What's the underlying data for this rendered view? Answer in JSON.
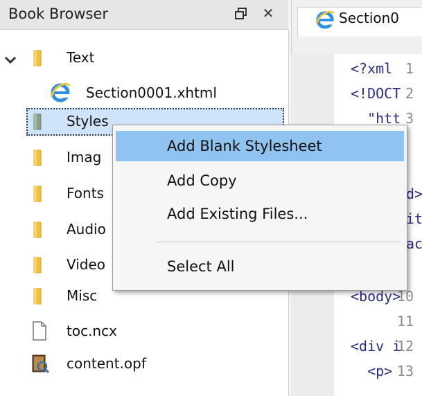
{
  "panel": {
    "title": "Book Browser"
  },
  "tree": {
    "items": [
      {
        "label": "Text",
        "icon": "folder-icon",
        "expanded": true
      },
      {
        "label": "Section0001.xhtml",
        "icon": "ie-icon"
      },
      {
        "label": "Styles",
        "icon": "folder-icon",
        "selected": true
      },
      {
        "label": "Imag",
        "icon": "folder-icon"
      },
      {
        "label": "Fonts",
        "icon": "folder-icon"
      },
      {
        "label": "Audio",
        "icon": "folder-icon"
      },
      {
        "label": "Video",
        "icon": "folder-icon"
      },
      {
        "label": "Misc",
        "icon": "folder-icon"
      },
      {
        "label": "toc.ncx",
        "icon": "document-icon"
      },
      {
        "label": "content.opf",
        "icon": "package-icon"
      }
    ]
  },
  "editor": {
    "tab_label": "Section0",
    "lines": [
      {
        "num": "1",
        "code": "<?xml"
      },
      {
        "num": "2",
        "code": "<!DOCT"
      },
      {
        "num": "3",
        "code": "  \"htt"
      },
      {
        "num": "10",
        "code": "<body>"
      },
      {
        "num": "11",
        "code": ""
      },
      {
        "num": "12",
        "code": "<div i"
      },
      {
        "num": "13",
        "code": "  <p>"
      }
    ],
    "partial": [
      "d>",
      "it",
      "ac"
    ]
  },
  "context_menu": {
    "items": [
      {
        "label": "Add Blank Stylesheet",
        "highlighted": true
      },
      {
        "label": "Add Copy"
      },
      {
        "label": "Add Existing Files..."
      },
      {
        "label": "Select All"
      }
    ]
  },
  "colors": {
    "folder": "#f2c23a",
    "selection": "#cfe4f8",
    "menu_highlight": "#90c3f0",
    "code_text": "#2c2c8a"
  }
}
